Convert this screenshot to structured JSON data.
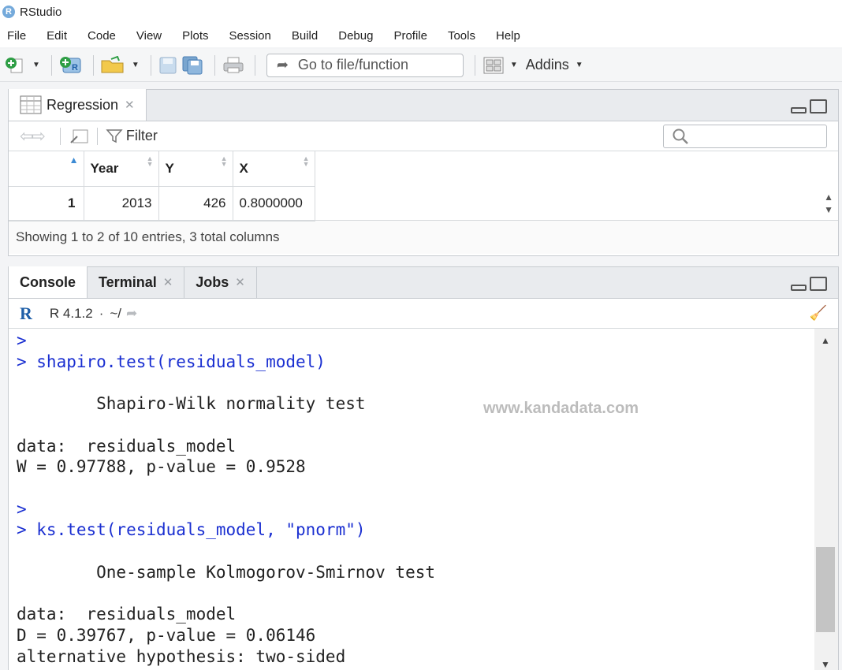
{
  "app": {
    "title": "RStudio",
    "logo_letter": "R"
  },
  "menu": [
    "File",
    "Edit",
    "Code",
    "View",
    "Plots",
    "Session",
    "Build",
    "Debug",
    "Profile",
    "Tools",
    "Help"
  ],
  "toolbar": {
    "goto_placeholder": "Go to file/function",
    "addins_label": "Addins"
  },
  "viewer": {
    "tab_label": "Regression",
    "filter_label": "Filter",
    "columns": [
      "Year",
      "Y",
      "X"
    ],
    "rows": [
      {
        "index": "1",
        "Year": "2013",
        "Y": "426",
        "X": "0.8000000"
      }
    ],
    "status": "Showing 1 to 2 of 10 entries, 3 total columns"
  },
  "console_pane": {
    "tabs": [
      "Console",
      "Terminal",
      "Jobs"
    ],
    "r_version": "R 4.1.2",
    "separator": "·",
    "working_dir": "~/",
    "watermark": "www.kandadata.com",
    "lines": [
      {
        "text": ">",
        "kind": "cmd"
      },
      {
        "text": "> shapiro.test(residuals_model)",
        "kind": "cmd"
      },
      {
        "text": "",
        "kind": "out"
      },
      {
        "text": "        Shapiro-Wilk normality test",
        "kind": "out"
      },
      {
        "text": "",
        "kind": "out"
      },
      {
        "text": "data:  residuals_model",
        "kind": "out"
      },
      {
        "text": "W = 0.97788, p-value = 0.9528",
        "kind": "out"
      },
      {
        "text": "",
        "kind": "out"
      },
      {
        "text": ">",
        "kind": "cmd"
      },
      {
        "text": "> ks.test(residuals_model, \"pnorm\")",
        "kind": "cmd"
      },
      {
        "text": "",
        "kind": "out"
      },
      {
        "text": "        One-sample Kolmogorov-Smirnov test",
        "kind": "out"
      },
      {
        "text": "",
        "kind": "out"
      },
      {
        "text": "data:  residuals_model",
        "kind": "out"
      },
      {
        "text": "D = 0.39767, p-value = 0.06146",
        "kind": "out"
      },
      {
        "text": "alternative hypothesis: two-sided",
        "kind": "out"
      }
    ]
  },
  "colors": {
    "command_blue": "#1a2fd1",
    "r_logo_blue": "#1f5fa8",
    "sort_active": "#3d8bd4"
  }
}
